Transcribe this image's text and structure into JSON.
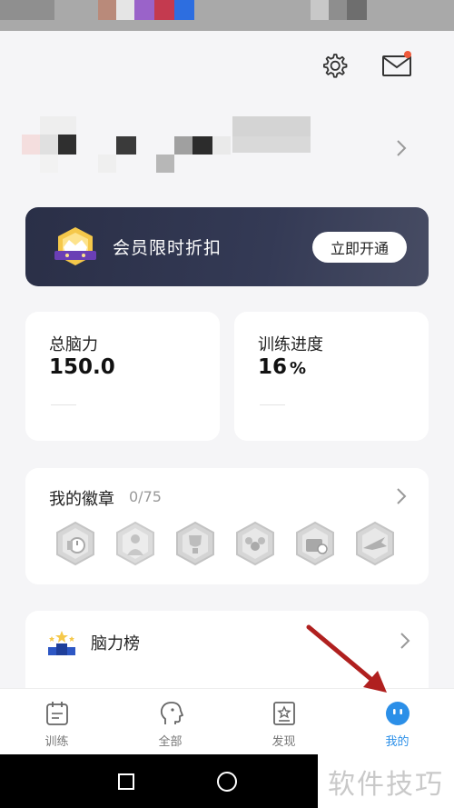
{
  "vip": {
    "title": "会员限时折扣",
    "button": "立即开通"
  },
  "stats": [
    {
      "label": "总脑力",
      "value": "150.0",
      "unit": ""
    },
    {
      "label": "训练进度",
      "value": "16",
      "unit": "%"
    }
  ],
  "badges": {
    "title": "我的徽章",
    "count": "0/75",
    "icons": [
      "timer-badge-icon",
      "person-badge-icon",
      "trophy-badge-icon",
      "group-badge-icon",
      "bag-badge-icon",
      "plane-badge-icon"
    ]
  },
  "ranking": {
    "title": "脑力榜"
  },
  "tabs": [
    {
      "label": "训练",
      "icon": "calendar-icon",
      "active": false
    },
    {
      "label": "全部",
      "icon": "head-icon",
      "active": false
    },
    {
      "label": "发现",
      "icon": "star-card-icon",
      "active": false
    },
    {
      "label": "我的",
      "icon": "face-icon",
      "active": true
    }
  ],
  "watermark": "软件技巧",
  "colors": {
    "accent": "#2b8fe8",
    "banner": "#2a2f47",
    "notification": "#f05a3b",
    "annotation_arrow": "#b0201f"
  }
}
